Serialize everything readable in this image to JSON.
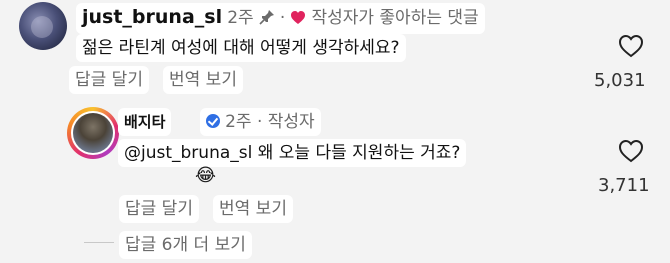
{
  "comment1": {
    "username": "just_bruna_sl",
    "time": "2주",
    "liked_by_author": "작성자가 좋아하는 댓글",
    "text": "젊은 라틴계 여성에 대해 어떻게 생각하세요?",
    "reply_action": "답글 달기",
    "translate_action": "번역 보기",
    "like_count": "5,031"
  },
  "reply1": {
    "username": "배지타",
    "meta": "2주 · 작성자",
    "text": "@just_bruna_sl 왜 오늘 다들 지원하는 거죠?",
    "emoji": "😂",
    "reply_action": "답글 달기",
    "translate_action": "번역 보기",
    "like_count": "3,711"
  },
  "more_replies": "답글 6개 더 보기",
  "colors": {
    "heart_red": "#e0245e",
    "verified_blue": "#2f6fe4",
    "pin_gray": "#6b6b6b"
  }
}
